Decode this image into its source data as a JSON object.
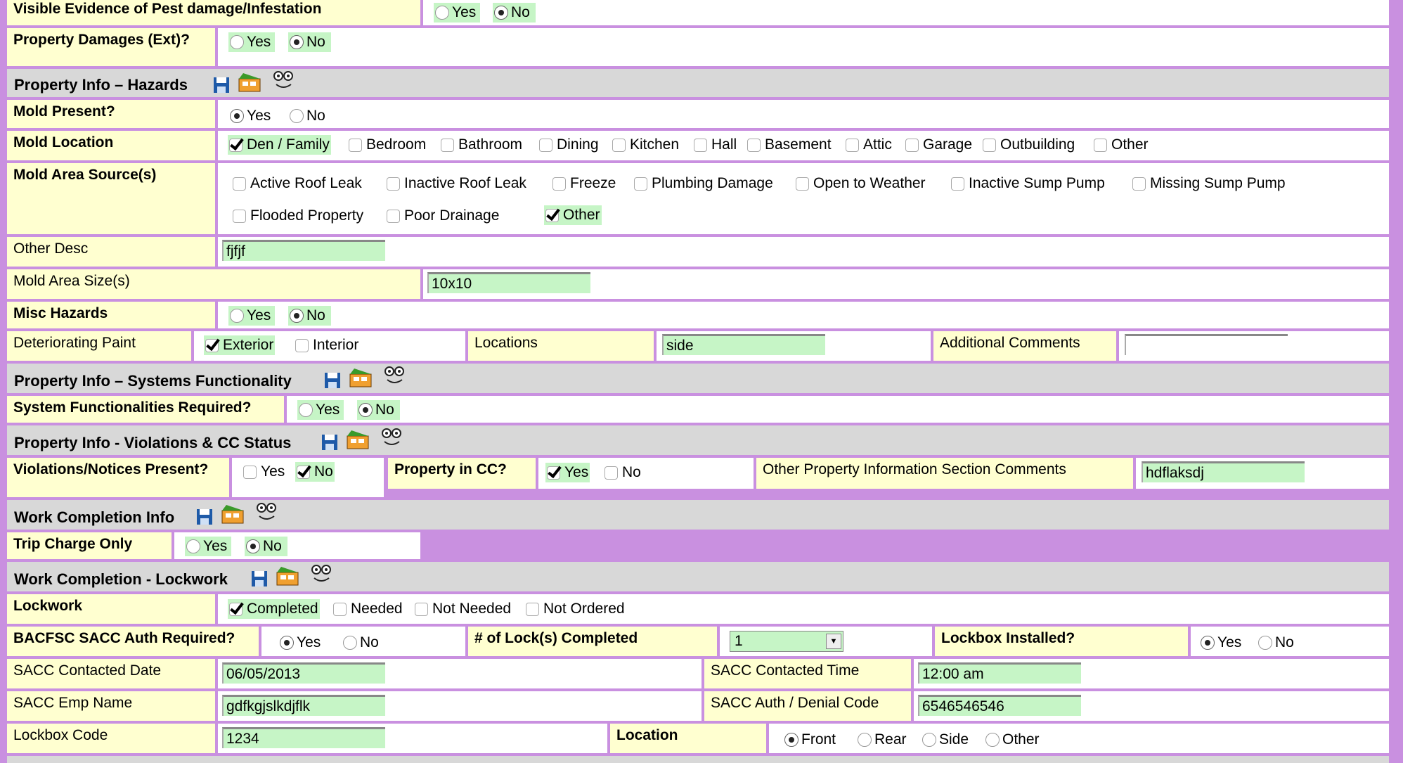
{
  "pest": {
    "label": "Visible Evidence of Pest damage/Infestation",
    "yes": "Yes",
    "no": "No"
  },
  "damages": {
    "label": "Property Damages (Ext)?",
    "yes": "Yes",
    "no": "No"
  },
  "sections": {
    "hazards": "Property Info – Hazards",
    "systems": "Property Info – Systems Functionality",
    "violations": "Property Info - Violations & CC Status",
    "work": "Work Completion Info",
    "lockwork": "Work Completion - Lockwork"
  },
  "mold_present": {
    "label": "Mold Present?",
    "yes": "Yes",
    "no": "No"
  },
  "mold_location": {
    "label": "Mold Location",
    "options": [
      "Den / Family",
      "Bedroom",
      "Bathroom",
      "Dining",
      "Kitchen",
      "Hall",
      "Basement",
      "Attic",
      "Garage",
      "Outbuilding",
      "Other"
    ]
  },
  "mold_source": {
    "label": "Mold Area Source(s)",
    "options": [
      "Active Roof Leak",
      "Inactive Roof Leak",
      "Freeze",
      "Plumbing Damage",
      "Open to Weather",
      "Inactive Sump Pump",
      "Missing Sump Pump",
      "Flooded Property",
      "Poor Drainage",
      "Other"
    ]
  },
  "other_desc": {
    "label": "Other Desc",
    "value": "fjfjf"
  },
  "mold_size": {
    "label": "Mold Area Size(s)",
    "value": "10x10"
  },
  "misc_hazards": {
    "label": "Misc Hazards",
    "yes": "Yes",
    "no": "No"
  },
  "paint": {
    "label": "Deteriorating Paint",
    "exterior": "Exterior",
    "interior": "Interior",
    "locations_label": "Locations",
    "locations_value": "side",
    "comments_label": "Additional Comments",
    "comments_value": ""
  },
  "sysfunc": {
    "label": "System Functionalities Required?",
    "yes": "Yes",
    "no": "No"
  },
  "violations": {
    "label": "Violations/Notices Present?",
    "yes": "Yes",
    "no": "No",
    "cc_label": "Property in CC?",
    "cc_yes": "Yes",
    "cc_no": "No",
    "other_label": "Other Property Information Section Comments",
    "other_value": "hdflaksdj"
  },
  "trip": {
    "label": "Trip Charge Only",
    "yes": "Yes",
    "no": "No"
  },
  "lockwork": {
    "label": "Lockwork",
    "options": [
      "Completed",
      "Needed",
      "Not Needed",
      "Not Ordered"
    ]
  },
  "bacfsc": {
    "label": "BACFSC SACC Auth Required?",
    "yes": "Yes",
    "no": "No",
    "locks_label": "# of Lock(s) Completed",
    "locks_value": "1",
    "lockbox_label": "Lockbox Installed?",
    "lockbox_yes": "Yes",
    "lockbox_no": "No"
  },
  "sacc_date": {
    "label": "SACC Contacted Date",
    "value": "06/05/2013",
    "time_label": "SACC Contacted Time",
    "time_value": "12:00 am"
  },
  "sacc_emp": {
    "label": "SACC Emp Name",
    "value": "gdfkgjslkdjflk",
    "code_label": "SACC Auth / Denial Code",
    "code_value": "6546546546"
  },
  "lockbox": {
    "label": "Lockbox Code",
    "value": "1234",
    "location_label": "Location",
    "locations": [
      "Front",
      "Rear",
      "Side",
      "Other"
    ]
  },
  "colors": {
    "background": "#c990e0",
    "label_bg": "#ffffd0",
    "section_bg": "#d8d8d8",
    "field_bg": "#c6f5c6"
  },
  "icons": [
    "save-icon",
    "notes-icon",
    "face-icon"
  ]
}
